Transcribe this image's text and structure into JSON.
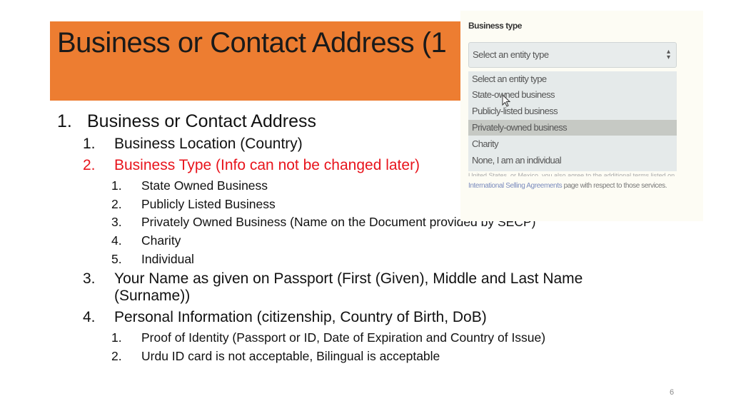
{
  "slide": {
    "title": "Business or Contact Address (1",
    "page_number": "6",
    "accent_color": "#ed7d31",
    "highlight_color": "#e8141c"
  },
  "outline": [
    {
      "num": "1.",
      "text": "Business or Contact Address",
      "level": 1
    },
    {
      "num": "1.",
      "text": "Business Location (Country)",
      "level": 2
    },
    {
      "num": "2.",
      "text": "Business Type (Info can not be changed later)",
      "level": 2,
      "highlight": true
    },
    {
      "num": "1.",
      "text": "State Owned Business",
      "level": 3
    },
    {
      "num": "2.",
      "text": "Publicly Listed Business",
      "level": 3
    },
    {
      "num": "3.",
      "text": "Privately Owned Business (Name on the Document provided by SECP)",
      "level": 3
    },
    {
      "num": "4.",
      "text": "Charity",
      "level": 3
    },
    {
      "num": "5.",
      "text": "Individual",
      "level": 3
    },
    {
      "num": "3.",
      "text": "Your Name as given on Passport (First (Given), Middle and Last Name",
      "level": 2
    },
    {
      "num": "",
      "text": "(Surname))",
      "level": 2
    },
    {
      "num": "4.",
      "text": "Personal Information (citizenship, Country of Birth, DoB)",
      "level": 2
    },
    {
      "num": "1.",
      "text": "Proof of Identity (Passport or ID, Date of Expiration and Country of Issue)",
      "level": 3
    },
    {
      "num": "2.",
      "text": "Urdu ID card is not acceptable, Bilingual is acceptable",
      "level": 3
    }
  ],
  "screenshot": {
    "label": "Business type",
    "select_value": "Select an entity type",
    "select_icon": "updown-arrows-icon",
    "options": [
      "Select an entity type",
      "State-owned business",
      "Publicly-listed business",
      "Privately-owned business",
      "Charity",
      "None, I am an individual"
    ],
    "selected_option_index": 3,
    "faded_text": "United States, or Mexico, you also agree to the additional terms listed on the",
    "footer_link": "International Selling Agreements",
    "footer_text": " page with respect to those services."
  }
}
